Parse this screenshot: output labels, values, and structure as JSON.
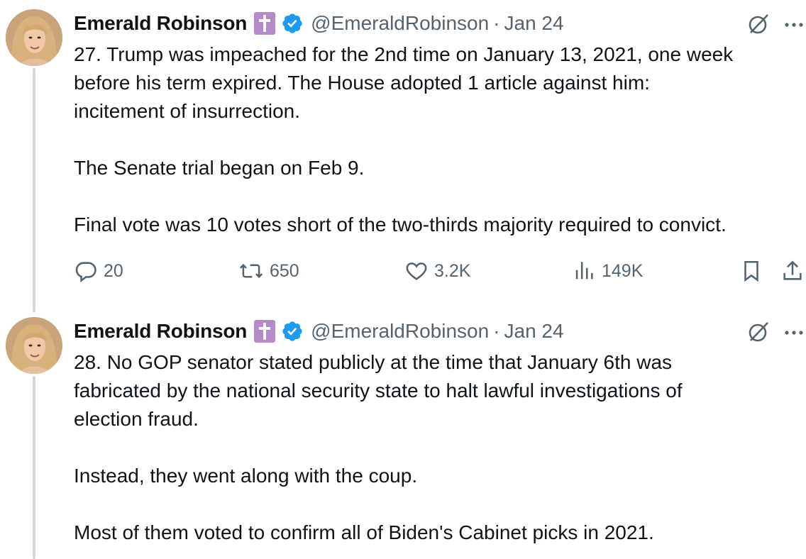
{
  "tweets": [
    {
      "author": {
        "name": "Emerald Robinson",
        "handle": "@EmeraldRobinson",
        "separator": "·",
        "date": "Jan 24"
      },
      "text_lines": [
        "27. Trump was impeached for the 2nd time on January 13, 2021, one week",
        "before his term expired. The House adopted 1 article against him:",
        "incitement of insurrection.",
        "",
        "The Senate trial began on Feb 9.",
        "",
        "Final vote was 10 votes short of the two-thirds majority required to convict."
      ],
      "stats": {
        "replies": "20",
        "reposts": "650",
        "likes": "3.2K",
        "views": "149K"
      }
    },
    {
      "author": {
        "name": "Emerald Robinson",
        "handle": "@EmeraldRobinson",
        "separator": "·",
        "date": "Jan 24"
      },
      "text_lines": [
        "28. No GOP senator stated publicly at the time that January 6th was",
        "fabricated by the national security state to halt lawful investigations of",
        "election fraud.",
        "",
        "Instead, they went along with the coup.",
        "",
        "Most of them voted to confirm all of Biden's Cabinet picks in 2021."
      ]
    }
  ],
  "icons": {
    "cross_badge": "cross-icon",
    "verified_badge": "verified-badge-icon",
    "grok": "grok-icon",
    "more": "more-icon",
    "reply": "reply-icon",
    "repost": "repost-icon",
    "like": "heart-icon",
    "views": "views-icon",
    "bookmark": "bookmark-icon",
    "share": "share-icon"
  },
  "colors": {
    "text": "#0f1419",
    "secondary": "#536471",
    "verified": "#1d9bf0",
    "cross_badge": "#b58ac9",
    "thread_line": "#cfd9de"
  }
}
